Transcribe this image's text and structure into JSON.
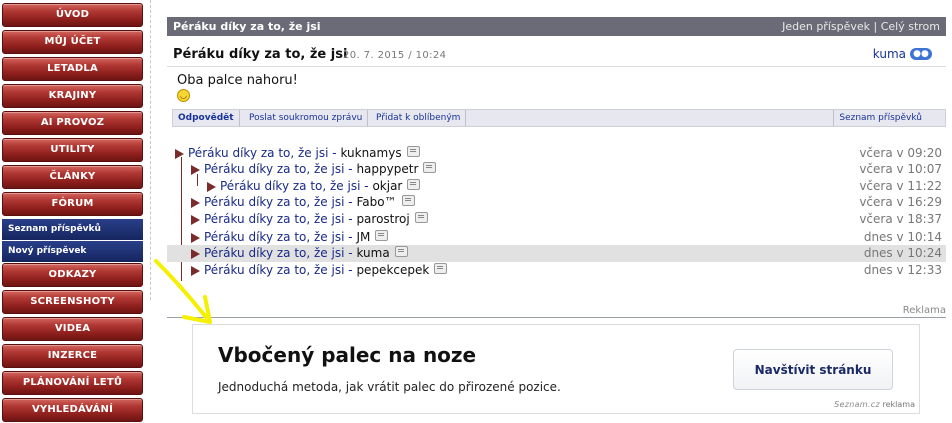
{
  "sidebar": {
    "items": [
      "ÚVOD",
      "MŮJ ÚČET",
      "LETADLA",
      "KRAJINY",
      "AI PROVOZ",
      "UTILITY",
      "ČLÁNKY",
      "FÓRUM"
    ],
    "forum_sub": [
      "Seznam příspěvků",
      "Nový příspěvek"
    ],
    "items_after": [
      "ODKAZY",
      "SCREENSHOTY",
      "VIDEA",
      "INZERCE",
      "PLÁNOVÁNÍ LETŮ",
      "VYHLEDÁVÁNÍ"
    ]
  },
  "post": {
    "header_title": "Péráku díky za to, že jsi",
    "header_links": "Jeden příspěvek | Celý strom",
    "title": "Péráku díky za to, že jsi",
    "date": "20. 7. 2015 / 10:24",
    "author": "kuma",
    "body": "Oba palce nahoru!"
  },
  "actions": {
    "reply": "Odpovědět",
    "private_message": "Poslat soukromou zprávu",
    "favorite": "Přidat k oblíbeným",
    "list": "Seznam příspěvků"
  },
  "thread": [
    {
      "subject": "Péráku díky za to, že jsi",
      "author": "kuknamys",
      "time": "včera v 09:20",
      "level": 0
    },
    {
      "subject": "Péráku díky za to, že jsi",
      "author": "happypetr",
      "time": "včera v 10:07",
      "level": 1
    },
    {
      "subject": "Péráku díky za to, že jsi",
      "author": "okjar",
      "time": "včera v 11:22",
      "level": 2
    },
    {
      "subject": "Péráku díky za to, že jsi",
      "author": "Fabo™",
      "time": "včera v 16:29",
      "level": 1
    },
    {
      "subject": "Péráku díky za to, že jsi",
      "author": "parostroj",
      "time": "včera v 18:37",
      "level": 1
    },
    {
      "subject": "Péráku díky za to, že jsi",
      "author": "JM",
      "time": "dnes v 10:14",
      "level": 1
    },
    {
      "subject": "Péráku díky za to, že jsi",
      "author": "kuma",
      "time": "dnes v 10:24",
      "level": 1,
      "current": true
    },
    {
      "subject": "Péráku díky za to, že jsi",
      "author": "pepekcepek",
      "time": "dnes v 12:33",
      "level": 1
    }
  ],
  "ad": {
    "label": "Reklama",
    "title": "Vbočený palec na noze",
    "text": "Jednoduchá metoda, jak vrátit palec do přirozené pozice.",
    "button": "Navštívit stránku",
    "footer_brand": "Seznam.cz",
    "footer_label": "reklama"
  },
  "colors": {
    "nav_red": "#9b2622",
    "sub_blue": "#1c2f72",
    "link_blue": "#1a2a88",
    "header_gray": "#6b6b78",
    "annotation_arrow": "#f4f000"
  }
}
